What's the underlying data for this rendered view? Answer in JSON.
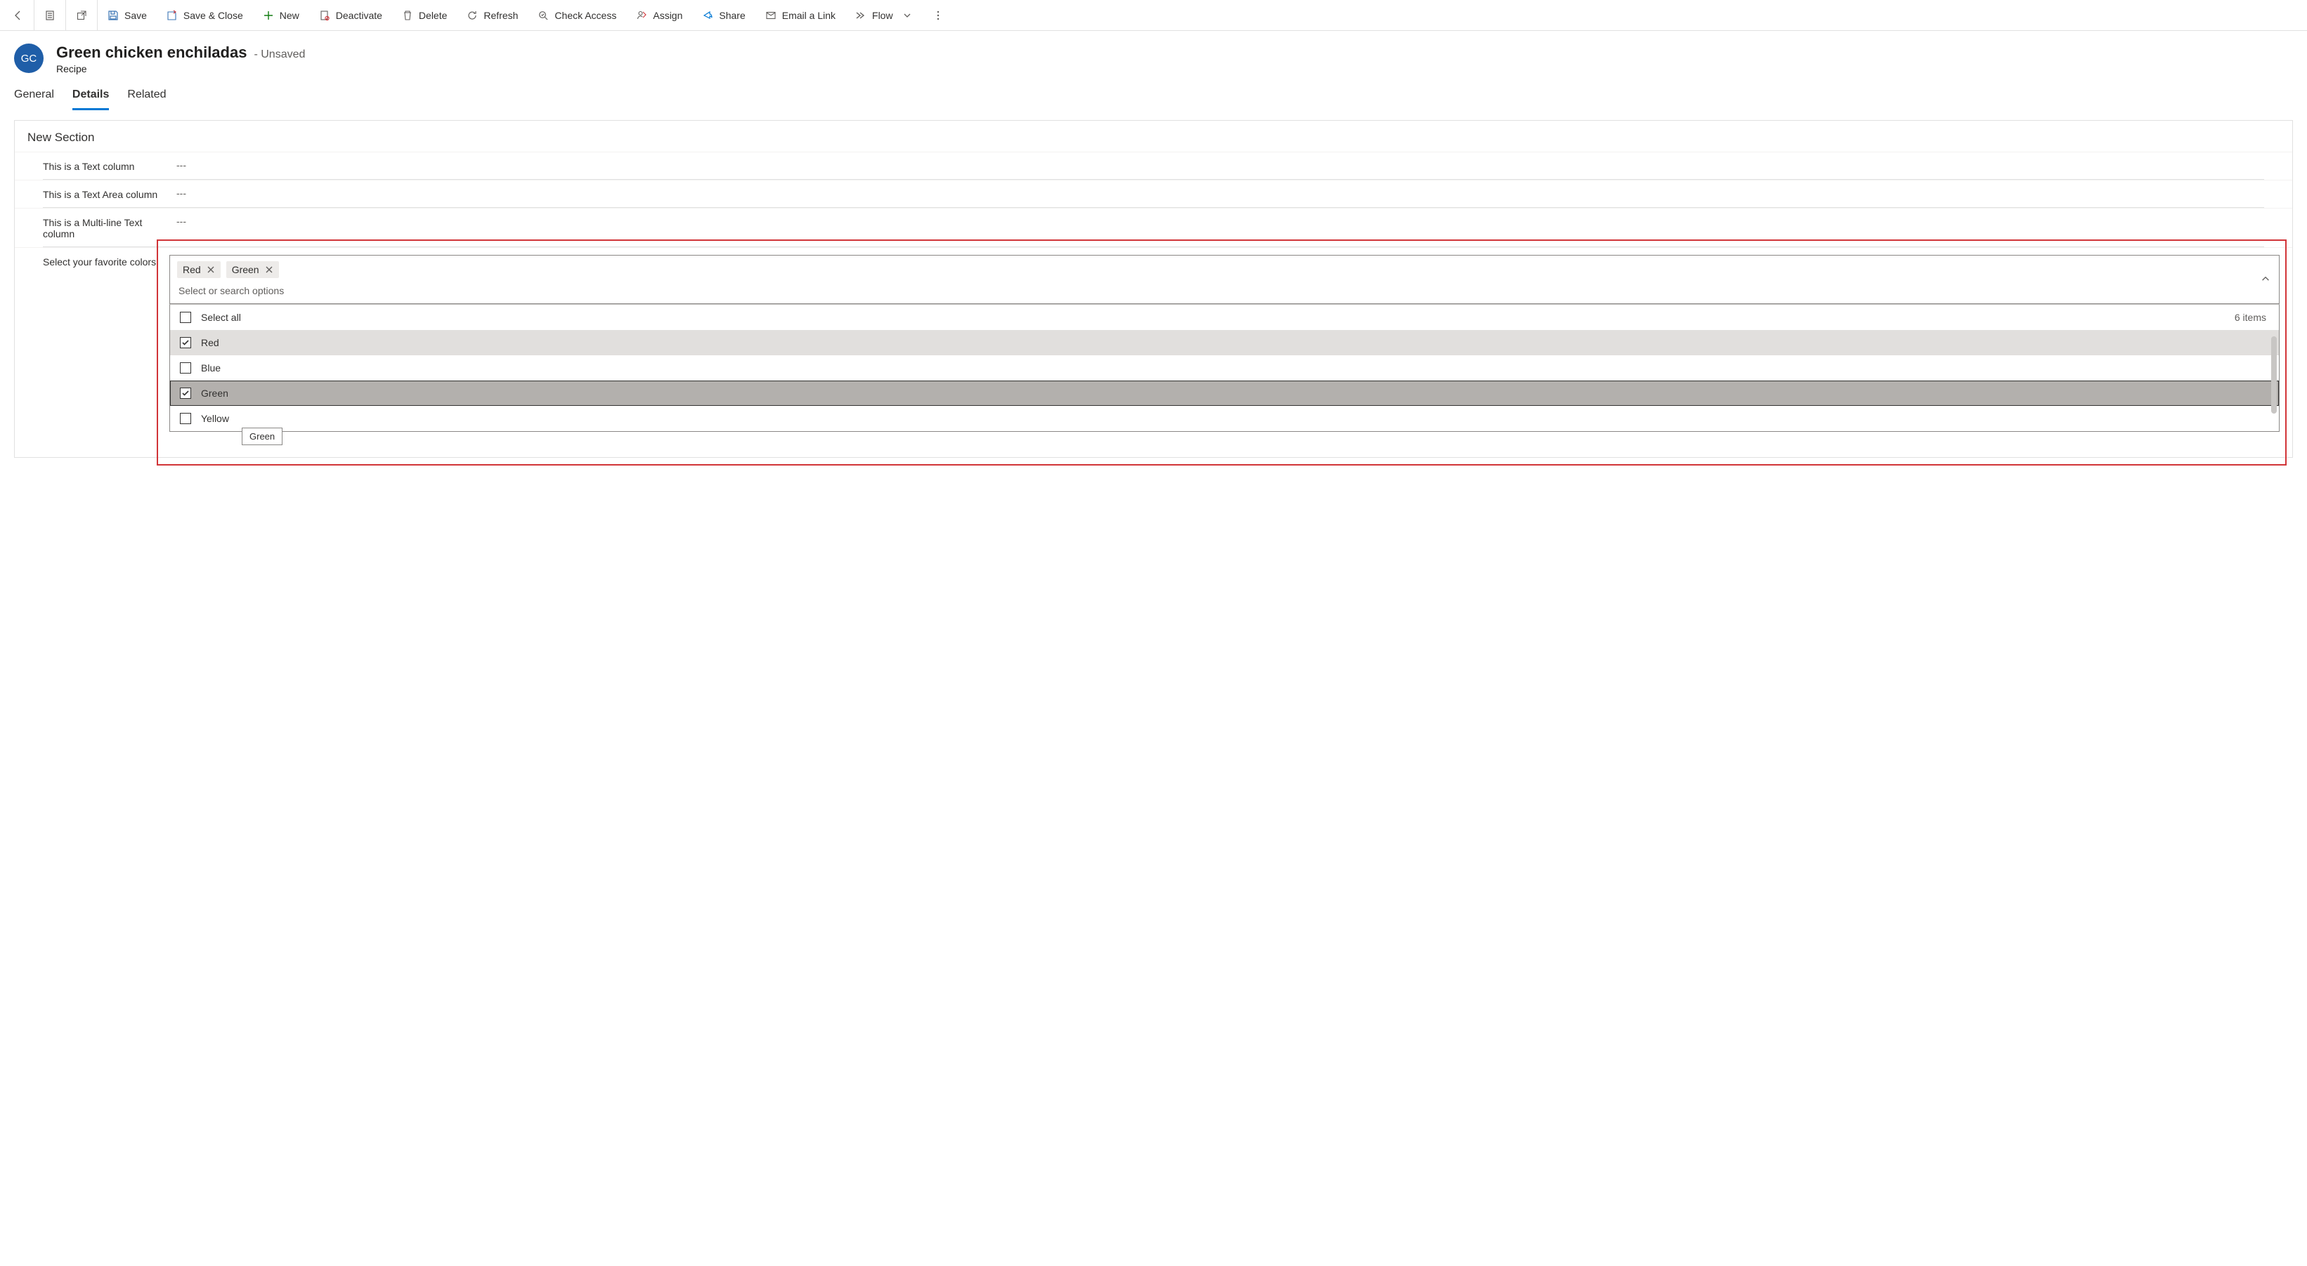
{
  "commandbar": {
    "save": "Save",
    "save_close": "Save & Close",
    "new": "New",
    "deactivate": "Deactivate",
    "delete": "Delete",
    "refresh": "Refresh",
    "check_access": "Check Access",
    "assign": "Assign",
    "share": "Share",
    "email_link": "Email a Link",
    "flow": "Flow"
  },
  "header": {
    "avatar_initials": "GC",
    "title": "Green chicken enchiladas",
    "status": "- Unsaved",
    "entity": "Recipe"
  },
  "tabs": {
    "general": "General",
    "details": "Details",
    "related": "Related"
  },
  "section": {
    "title": "New Section",
    "fields": {
      "text_label": "This is a Text column",
      "text_value": "---",
      "textarea_label": "This is a Text Area column",
      "textarea_value": "---",
      "multiline_label": "This is a Multi-line Text column",
      "multiline_value": "---",
      "colors_label": "Select your favorite colors"
    }
  },
  "multiselect": {
    "placeholder": "Select or search options",
    "selected": [
      {
        "label": "Red"
      },
      {
        "label": "Green"
      }
    ],
    "select_all_label": "Select all",
    "items_count": "6 items",
    "options": [
      {
        "label": "Red",
        "checked": true,
        "state": "selected"
      },
      {
        "label": "Blue",
        "checked": false,
        "state": ""
      },
      {
        "label": "Green",
        "checked": true,
        "state": "focused"
      },
      {
        "label": "Yellow",
        "checked": false,
        "state": ""
      }
    ],
    "tooltip": "Green"
  }
}
